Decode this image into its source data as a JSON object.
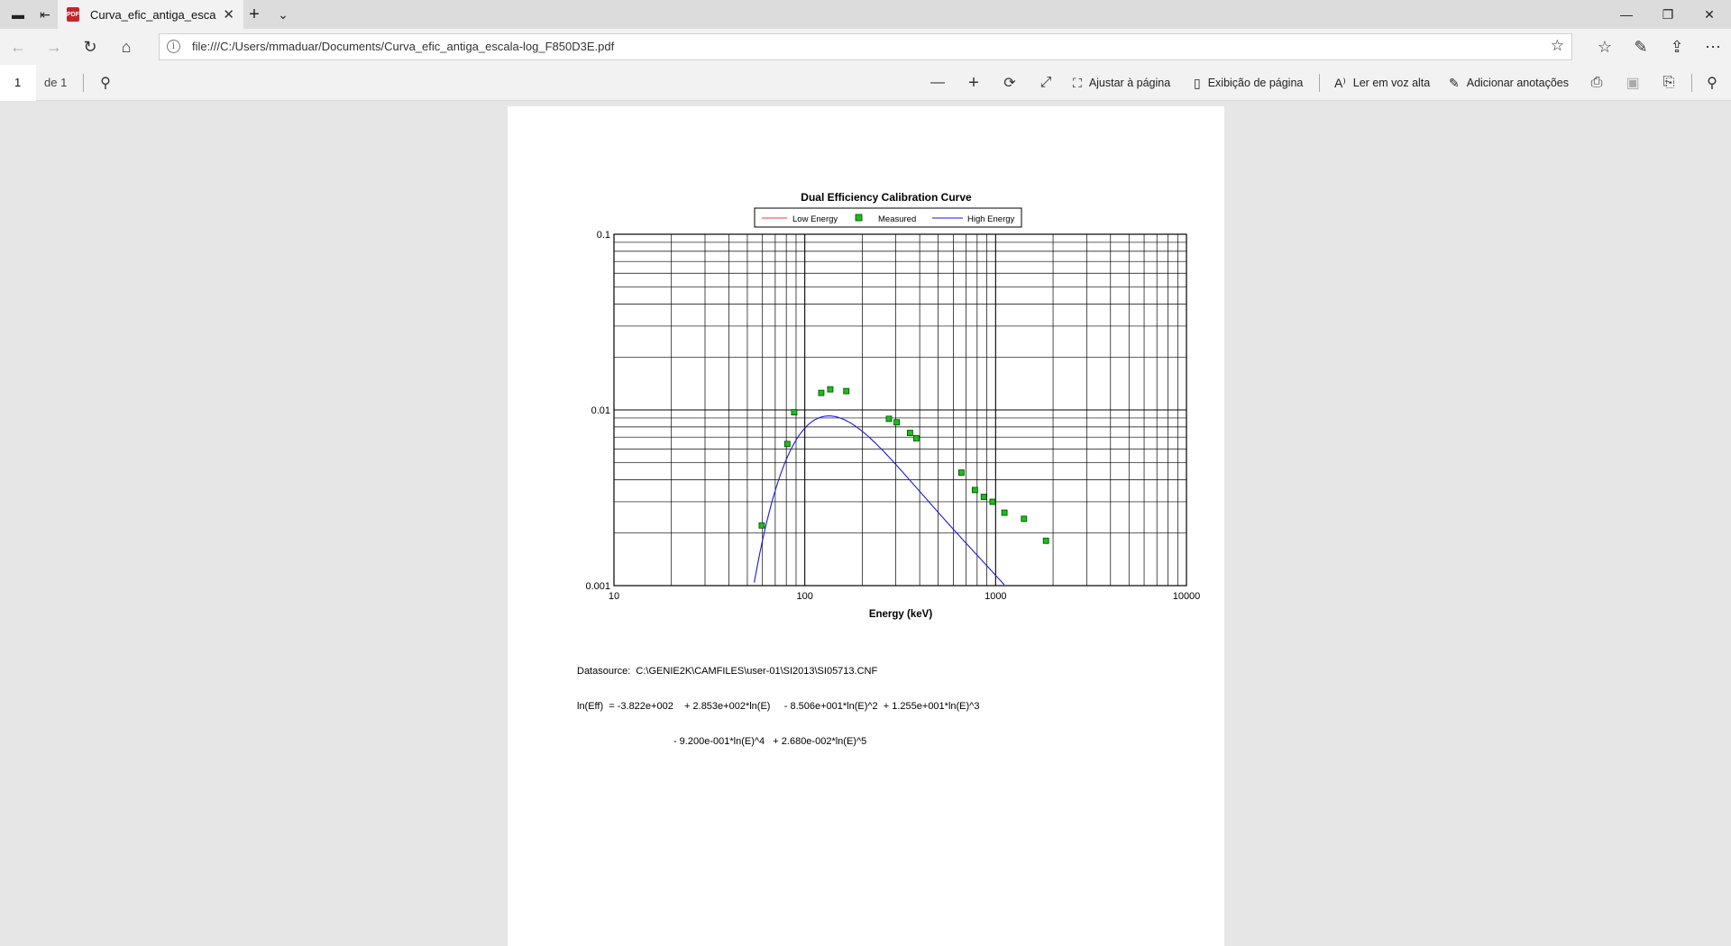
{
  "browser": {
    "tab_title": "Curva_efic_antiga_escal",
    "url": "file:///C:/Users/mmaduar/Documents/Curva_efic_antiga_escala-log_F850D3E.pdf"
  },
  "pdf_toolbar": {
    "page_number": "1",
    "page_of": "de 1",
    "fit_page_label": "Ajustar à página",
    "page_view_label": "Exibição de página",
    "read_aloud_label": "Ler em voz alta",
    "add_notes_label": "Adicionar anotações"
  },
  "document": {
    "datasource_line": "Datasource:  C:\\GENIE2K\\CAMFILES\\user-01\\SI2013\\SI05713.CNF",
    "formula_line1": "ln(Eff)  = -3.822e+002    + 2.853e+002*ln(E)     - 8.506e+001*ln(E)^2  + 1.255e+001*ln(E)^3",
    "formula_line2": "                                   - 9.200e-001*ln(E)^4   + 2.680e-002*ln(E)^5"
  },
  "chart_data": {
    "type": "scatter",
    "title": "Dual Efficiency Calibration Curve",
    "xlabel": "Energy (keV)",
    "ylabel": "",
    "x_scale": "log",
    "y_scale": "log",
    "xlim": [
      10,
      10000
    ],
    "ylim": [
      0.001,
      0.1
    ],
    "x_ticks": [
      "10",
      "100",
      "1000",
      "10000"
    ],
    "y_ticks": [
      "0.1",
      "0.01",
      "0.001"
    ],
    "grid": true,
    "legend_position": "top",
    "legend": [
      "Low Energy",
      "Measured",
      "High Energy"
    ],
    "colors": {
      "low_energy": "#ff3333",
      "measured_fill": "#19c019",
      "measured_edge": "#004400",
      "high_energy": "#1a1ad6"
    },
    "series": [
      {
        "name": "Measured",
        "x": [
          59.5,
          81,
          88,
          122,
          136,
          165,
          276,
          303,
          356,
          384,
          662,
          779,
          867,
          964,
          1112,
          1408,
          1836
        ],
        "y": [
          0.0022,
          0.0064,
          0.0097,
          0.0125,
          0.0131,
          0.0128,
          0.0089,
          0.0085,
          0.0074,
          0.0069,
          0.0044,
          0.0035,
          0.0032,
          0.003,
          0.0026,
          0.0024,
          0.0018
        ]
      },
      {
        "name": "High Energy",
        "coefficients": [
          -382.2,
          285.3,
          -85.06,
          12.55,
          -0.92,
          0.0268
        ]
      }
    ]
  }
}
